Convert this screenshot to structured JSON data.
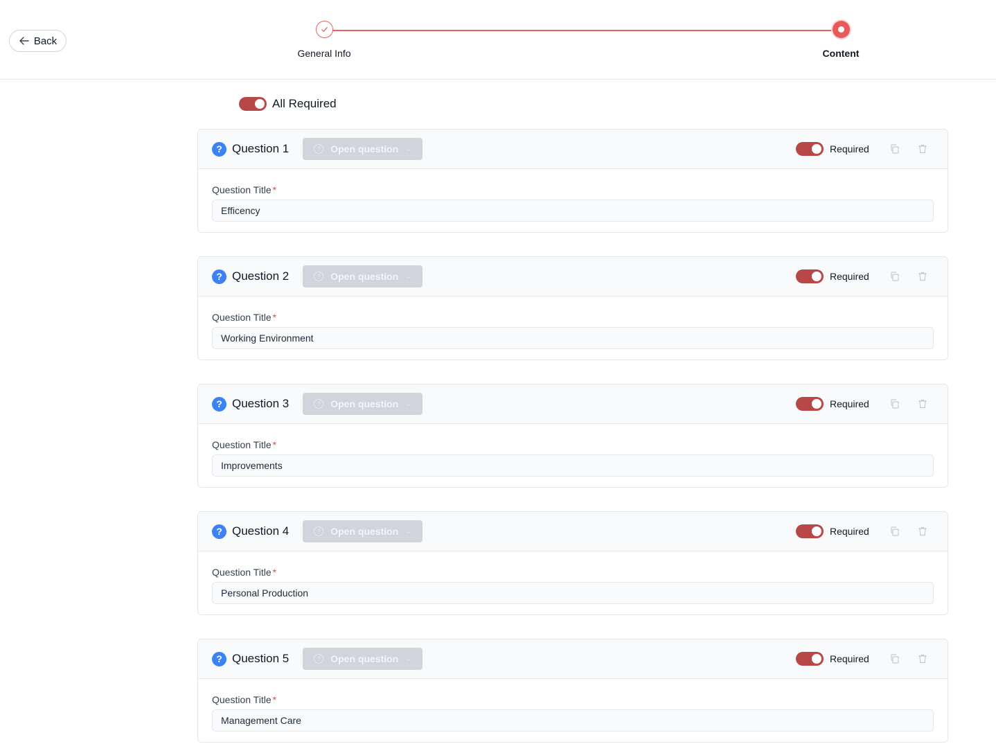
{
  "header": {
    "back_label": "Back",
    "steps": [
      {
        "label": "General Info",
        "status": "completed"
      },
      {
        "label": "Content",
        "status": "active"
      }
    ]
  },
  "all_required": {
    "label": "All Required",
    "enabled": true
  },
  "colors": {
    "accent": "#e26464",
    "toggle": "#b84848",
    "question_icon": "#3b82f6"
  },
  "questions": [
    {
      "title": "Question 1",
      "type": "Open question",
      "required_label": "Required",
      "required": true,
      "field_label": "Question Title",
      "field_value": "Efficency"
    },
    {
      "title": "Question 2",
      "type": "Open question",
      "required_label": "Required",
      "required": true,
      "field_label": "Question Title",
      "field_value": "Working Environment"
    },
    {
      "title": "Question 3",
      "type": "Open question",
      "required_label": "Required",
      "required": true,
      "field_label": "Question Title",
      "field_value": "Improvements"
    },
    {
      "title": "Question 4",
      "type": "Open question",
      "required_label": "Required",
      "required": true,
      "field_label": "Question Title",
      "field_value": "Personal Production"
    },
    {
      "title": "Question 5",
      "type": "Open question",
      "required_label": "Required",
      "required": true,
      "field_label": "Question Title",
      "field_value": "Management Care"
    }
  ]
}
